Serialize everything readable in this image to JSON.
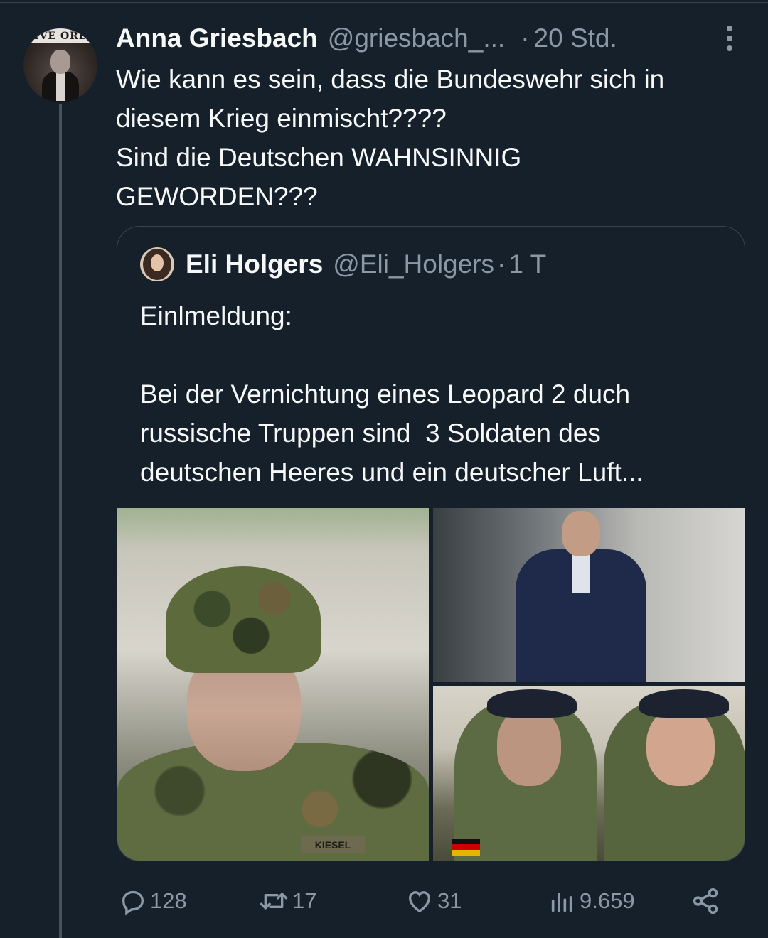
{
  "tweet": {
    "author_name": "Anna Griesbach",
    "author_handle": "@griesbach_...",
    "separator": "·",
    "time": "20 Std.",
    "avatar_banner_text": "IVE ORD",
    "text_lines": [
      "Wie kann es sein, dass die Bundeswehr sich in",
      "diesem Krieg einmischt????",
      "Sind die Deutschen WAHNSINNIG",
      "GEWORDEN???"
    ]
  },
  "quote": {
    "author_name": "Eli Holgers",
    "author_handle": "@Eli_Holgers",
    "separator": "·",
    "time": "1 T",
    "text_lines": [
      "Einlmeldung:",
      "",
      "Bei der Vernichtung eines Leopard 2 duch",
      "russische Truppen sind  3 Soldaten des",
      "deutschen Heeres und ein deutscher Luft..."
    ],
    "media": {
      "name_tag": "KIESEL"
    }
  },
  "actions": {
    "replies": "128",
    "reposts": "17",
    "likes": "31",
    "views": "9.659"
  },
  "colors": {
    "background": "#15202b",
    "text": "#f7f9f9",
    "secondary": "#8b98a5",
    "border": "#38444d"
  },
  "icons": {
    "more": "more-vertical-icon",
    "reply": "reply-icon",
    "repost": "repost-icon",
    "like": "heart-icon",
    "views": "views-chart-icon",
    "share": "share-icon"
  }
}
